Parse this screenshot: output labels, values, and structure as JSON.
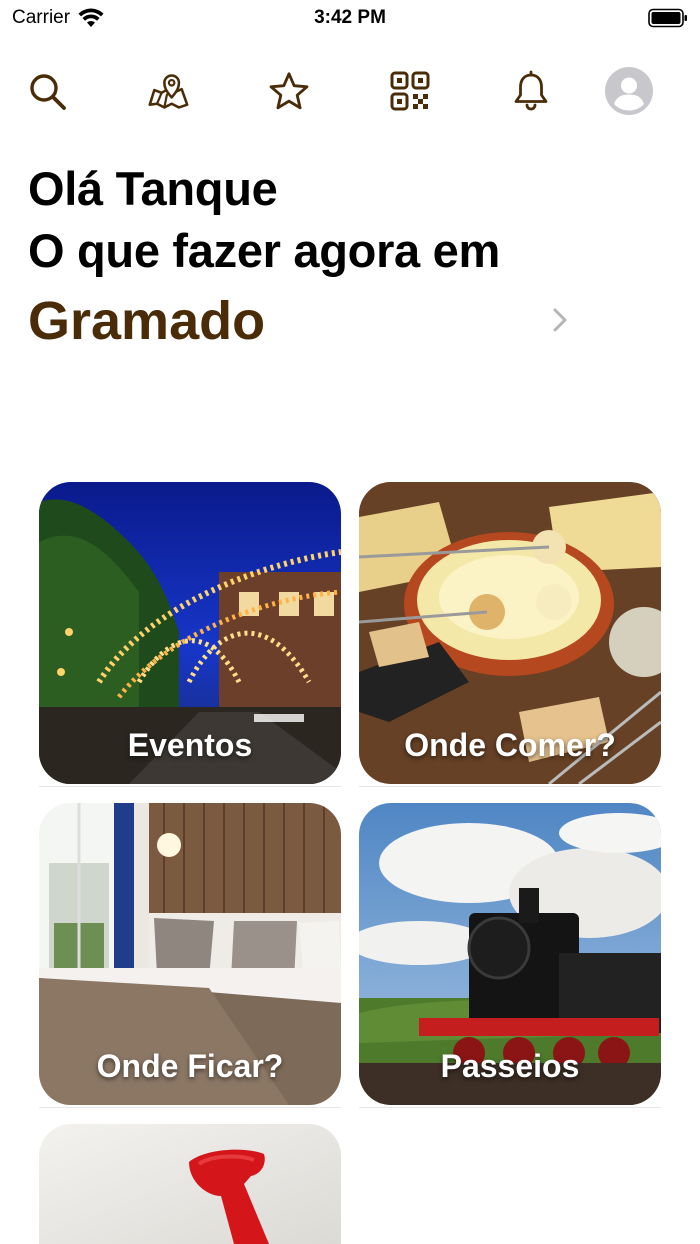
{
  "status_bar": {
    "carrier": "Carrier",
    "time": "3:42 PM"
  },
  "toolbar": {
    "icons": [
      "search-icon",
      "map-pin-icon",
      "star-icon",
      "qr-code-icon",
      "bell-icon",
      "avatar-icon"
    ],
    "icon_color": "#4a2c08"
  },
  "greeting": {
    "line1": "Olá Tanque",
    "line2": "O que fazer agora em",
    "city": "Gramado"
  },
  "categories": [
    {
      "label": "Eventos"
    },
    {
      "label": "Onde Comer?"
    },
    {
      "label": "Onde Ficar?"
    },
    {
      "label": "Passeios"
    }
  ],
  "colors": {
    "accent": "#4a2c08",
    "chevron": "#b5b5b5"
  }
}
